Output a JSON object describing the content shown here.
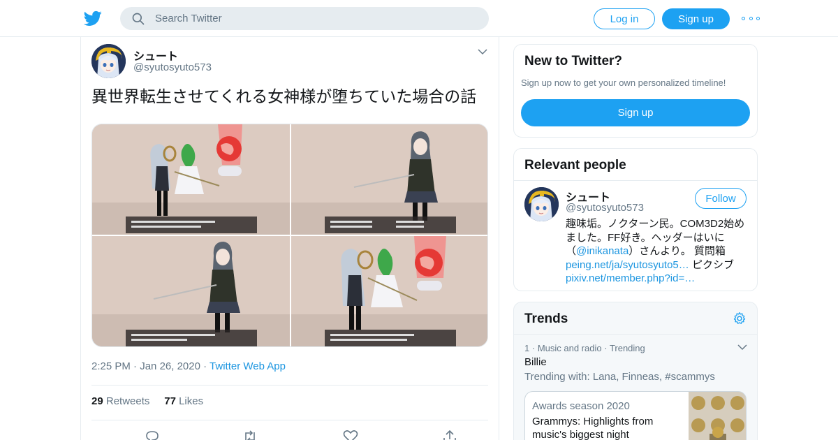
{
  "header": {
    "search_placeholder": "Search Twitter",
    "login_label": "Log in",
    "signup_label": "Sign up",
    "brand_color": "#1da1f2"
  },
  "tweet": {
    "author_name": "シュート",
    "author_handle": "@syutosyuto573",
    "text": "異世界転生させてくれる女神様が堕ちていた場合の話",
    "time": "2:25 PM",
    "date": "Jan 26, 2020",
    "source": "Twitter Web App",
    "retweets_count": "29",
    "retweets_label": "Retweets",
    "likes_count": "77",
    "likes_label": "Likes",
    "media_count": 4
  },
  "sidebar": {
    "new_to_twitter": {
      "title": "New to Twitter?",
      "subtitle": "Sign up now to get your own personalized timeline!",
      "button_label": "Sign up"
    },
    "relevant_people": {
      "title": "Relevant people",
      "name": "シュート",
      "handle": "@syutosyuto573",
      "follow_label": "Follow",
      "bio_1": "趣味垢。ノクターン民。COM3D2始めました。FF好き。ヘッダーはいに（",
      "bio_mention": "@inikanata",
      "bio_2": "）さんより。 質問箱",
      "bio_link_1": "peing.net/ja/syutosyuto5…",
      "bio_3": " ピクシブ",
      "bio_link_2": "pixiv.net/member.php?id=…"
    },
    "trends": {
      "title": "Trends",
      "item": {
        "rank": "1",
        "category": "Music and radio",
        "status": "Trending",
        "name": "Billie",
        "trending_with": "Trending with: Lana, Finneas, #scammys"
      },
      "moment": {
        "caption": "Awards season 2020",
        "headline": "Grammys: Highlights from music's biggest night"
      }
    }
  }
}
